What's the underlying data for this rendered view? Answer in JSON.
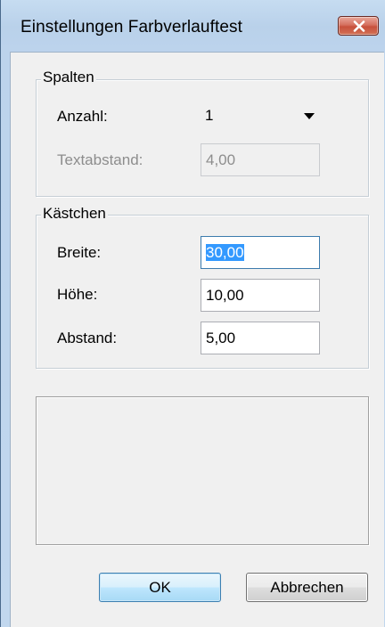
{
  "window": {
    "title": "Einstellungen Farbverlauftest"
  },
  "spalten": {
    "legend": "Spalten",
    "anzahl_label": "Anzahl:",
    "anzahl_value": "1",
    "textabstand_label": "Textabstand:",
    "textabstand_value": "4,00"
  },
  "kaestchen": {
    "legend": "Kästchen",
    "breite_label": "Breite:",
    "breite_value": "30,00",
    "hoehe_label": "Höhe:",
    "hoehe_value": "10,00",
    "abstand_label": "Abstand:",
    "abstand_value": "5,00"
  },
  "buttons": {
    "ok_label": "OK",
    "cancel_label": "Abbrechen"
  },
  "icons": {
    "close": "close-icon",
    "dropdown": "chevron-down-icon"
  },
  "colors": {
    "titlebar": "#b9d1ea",
    "close_button": "#c7503c",
    "selection": "#3399ff",
    "default_button": "#bee6fd"
  }
}
